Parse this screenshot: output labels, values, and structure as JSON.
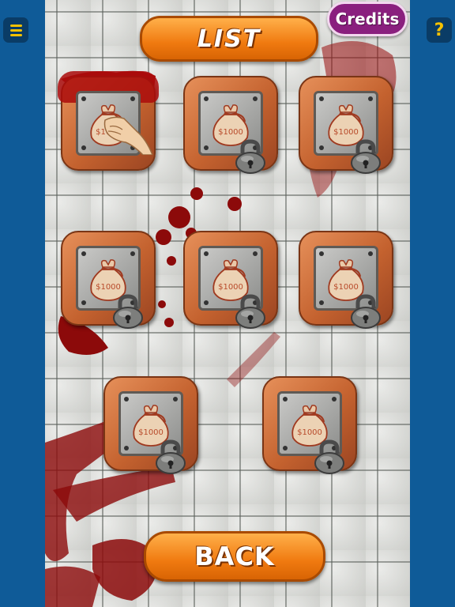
{
  "header": {
    "title": "LIST",
    "credits_label": "Credits"
  },
  "sidebar": {
    "menu_icon": "hamburger-menu-icon",
    "help_label": "?"
  },
  "bag_label": "$1000",
  "levels": [
    {
      "state": "unlocked",
      "icon": "money-bag-icon"
    },
    {
      "state": "locked",
      "icon": "money-bag-icon"
    },
    {
      "state": "locked",
      "icon": "money-bag-icon"
    },
    {
      "state": "locked",
      "icon": "money-bag-icon"
    },
    {
      "state": "locked",
      "icon": "money-bag-icon"
    },
    {
      "state": "locked",
      "icon": "money-bag-icon"
    },
    {
      "state": "locked",
      "icon": "money-bag-icon"
    },
    {
      "state": "locked",
      "icon": "money-bag-icon"
    }
  ],
  "footer": {
    "back_label": "BACK"
  },
  "colors": {
    "accent_orange": "#f07a10",
    "credits_purple": "#8a1f7e",
    "sidebar_blue": "#0f5b98",
    "blood_red": "#8c0a0a"
  }
}
